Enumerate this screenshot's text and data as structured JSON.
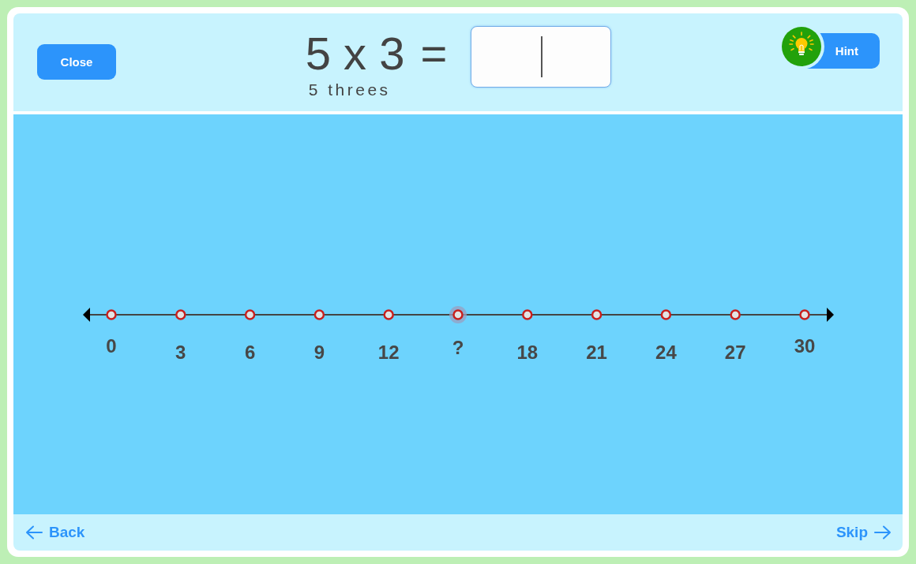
{
  "header": {
    "close_button": "Close",
    "equation": {
      "expression": "5 x 3",
      "equals": "=",
      "reading": "5 threes"
    },
    "answer_field": {
      "focused": true
    },
    "hint_button": "Hint"
  },
  "number_line": {
    "points": [
      {
        "label": "0",
        "selected": false
      },
      {
        "label": "3",
        "selected": false
      },
      {
        "label": "6",
        "selected": false
      },
      {
        "label": "9",
        "selected": false
      },
      {
        "label": "12",
        "selected": false
      },
      {
        "label": "?",
        "selected": true
      },
      {
        "label": "18",
        "selected": false
      },
      {
        "label": "21",
        "selected": false
      },
      {
        "label": "24",
        "selected": false
      },
      {
        "label": "27",
        "selected": false
      },
      {
        "label": "30",
        "selected": false
      }
    ]
  },
  "footer": {
    "back_link": "Back",
    "skip_link": "Skip"
  }
}
